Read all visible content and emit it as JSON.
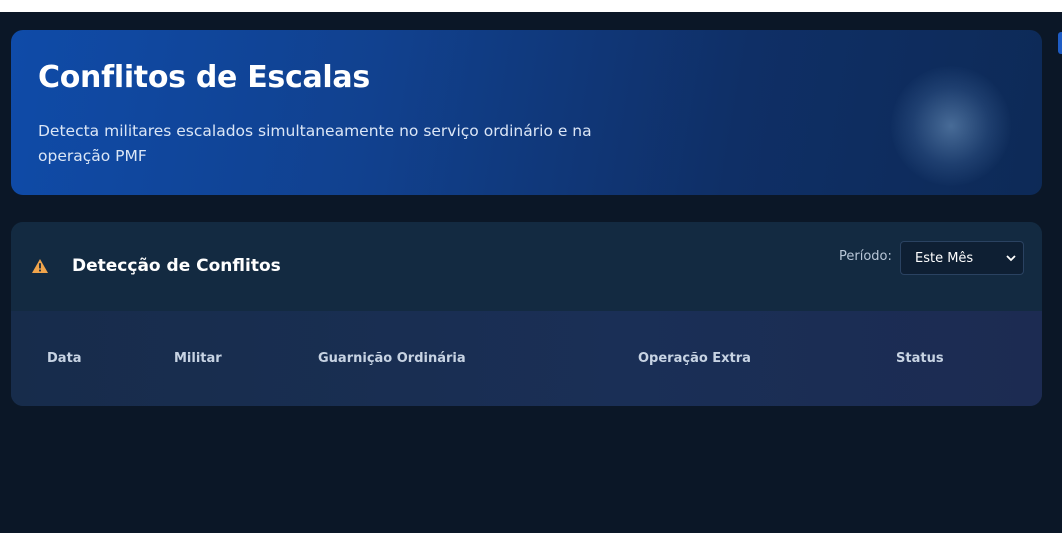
{
  "hero": {
    "title": "Conflitos de Escalas",
    "subtitle": "Detecta militares escalados simultaneamente no serviço ordinário e na operação PMF"
  },
  "panel": {
    "title": "Detecção de Conflitos",
    "period_label": "Período:",
    "period_selected": "Este Mês",
    "columns": [
      "Data",
      "Militar",
      "Guarnição Ordinária",
      "Operação Extra",
      "Status"
    ]
  },
  "colors": {
    "background": "#0b1727",
    "hero_start": "#0f4ba8",
    "hero_end": "#0d2a57",
    "warning": "#f0a44b"
  },
  "icons": {
    "warning": "warning-triangle-icon",
    "select_caret": "chevron-down-icon"
  }
}
